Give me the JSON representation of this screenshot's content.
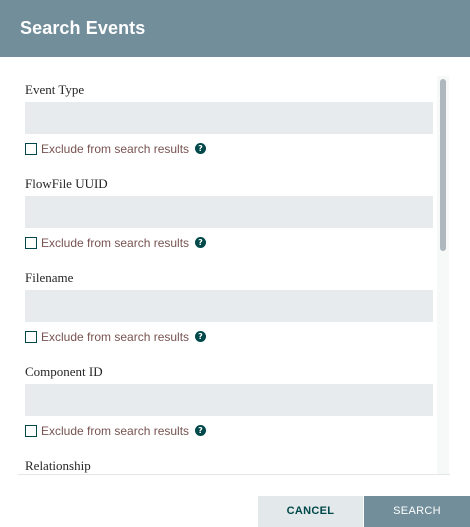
{
  "dialog": {
    "title": "Search Events"
  },
  "fields": [
    {
      "label": "Event Type",
      "value": "",
      "exclude_label": "Exclude from search results",
      "exclude_checked": false
    },
    {
      "label": "FlowFile UUID",
      "value": "",
      "exclude_label": "Exclude from search results",
      "exclude_checked": false
    },
    {
      "label": "Filename",
      "value": "",
      "exclude_label": "Exclude from search results",
      "exclude_checked": false
    },
    {
      "label": "Component ID",
      "value": "",
      "exclude_label": "Exclude from search results",
      "exclude_checked": false
    },
    {
      "label": "Relationship"
    }
  ],
  "icons": {
    "help": "question-circle-icon",
    "help_glyph": "?"
  },
  "buttons": {
    "cancel": "CANCEL",
    "search": "SEARCH"
  },
  "colors": {
    "header_bg": "#728e9b",
    "input_bg": "#e8ebed",
    "accent_dark_teal": "#004849",
    "exclude_text": "#775351",
    "cancel_bg": "#e3e8eb"
  }
}
